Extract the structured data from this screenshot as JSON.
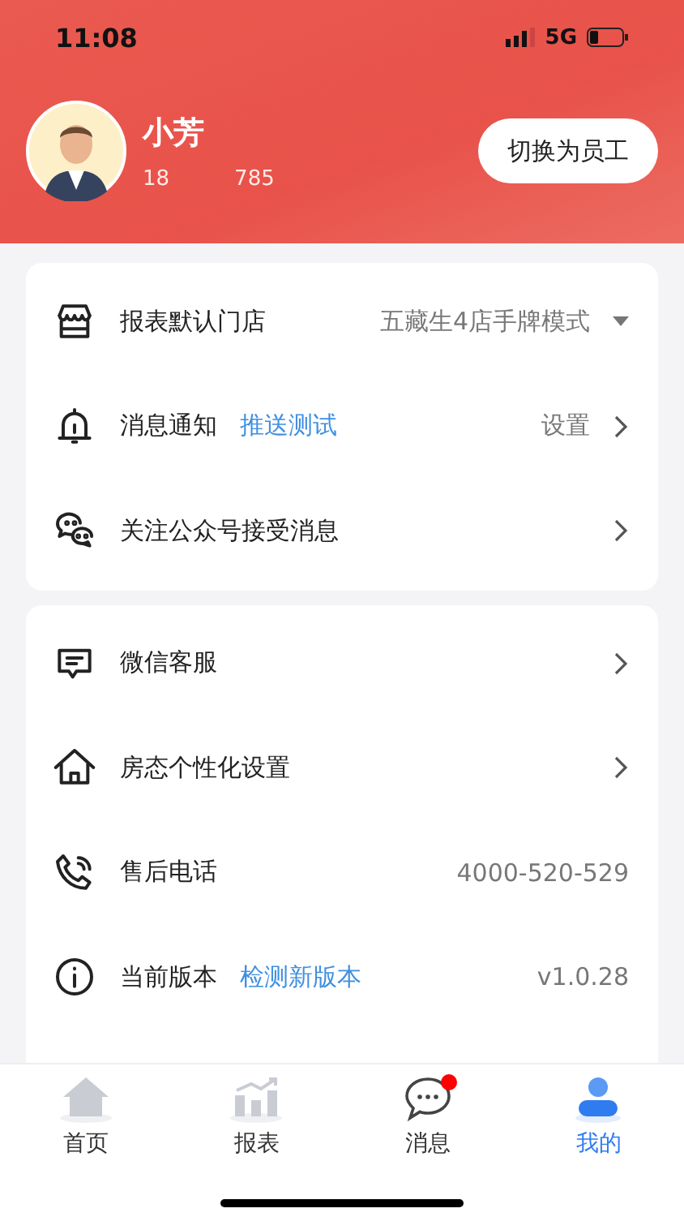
{
  "status_bar": {
    "time": "11:08",
    "network": "5G"
  },
  "profile": {
    "name": "小芳",
    "phone_start": "18",
    "phone_end": "785",
    "switch_button": "切换为员工"
  },
  "settings_group_1": [
    {
      "kind": "dropdown",
      "label": "报表默认门店",
      "value": "五藏生4店手牌模式"
    },
    {
      "kind": "link",
      "label": "消息通知",
      "link": "推送测试",
      "value": "设置"
    },
    {
      "kind": "link",
      "label": "关注公众号接受消息"
    }
  ],
  "settings_group_2": [
    {
      "kind": "link",
      "label": "微信客服"
    },
    {
      "kind": "link",
      "label": "房态个性化设置"
    },
    {
      "kind": "value",
      "label": "售后电话",
      "value": "4000-520-529"
    },
    {
      "kind": "value",
      "label": "当前版本",
      "link": "检测新版本",
      "value": "v1.0.28"
    }
  ],
  "tab_bar": [
    {
      "label": "首页",
      "selected": false,
      "badge": false
    },
    {
      "label": "报表",
      "selected": false,
      "badge": false
    },
    {
      "label": "消息",
      "selected": false,
      "badge": true
    },
    {
      "label": "我的",
      "selected": true,
      "badge": false
    }
  ]
}
